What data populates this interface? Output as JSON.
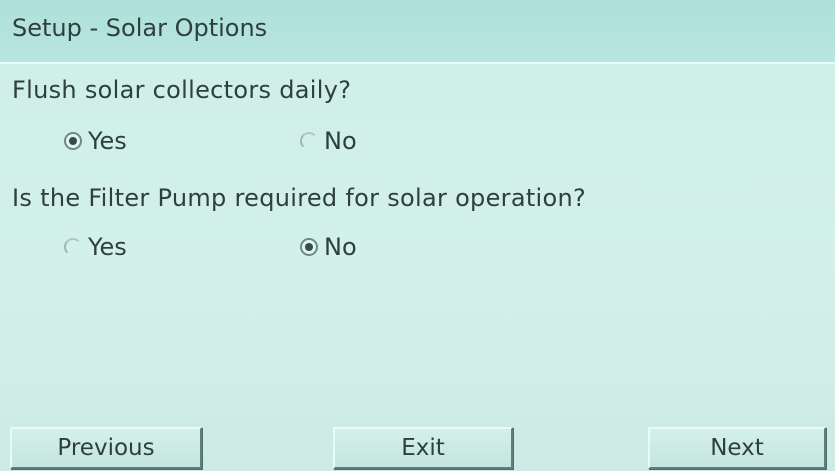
{
  "header": {
    "title": "Setup - Solar Options"
  },
  "questions": [
    {
      "text": "Flush solar collectors daily?",
      "options": [
        {
          "label": "Yes",
          "selected": true
        },
        {
          "label": "No",
          "selected": false
        }
      ]
    },
    {
      "text": "Is the Filter Pump required for solar operation?",
      "options": [
        {
          "label": "Yes",
          "selected": false
        },
        {
          "label": "No",
          "selected": true
        }
      ]
    }
  ],
  "footer": {
    "previous_label": "Previous",
    "exit_label": "Exit",
    "next_label": "Next"
  }
}
